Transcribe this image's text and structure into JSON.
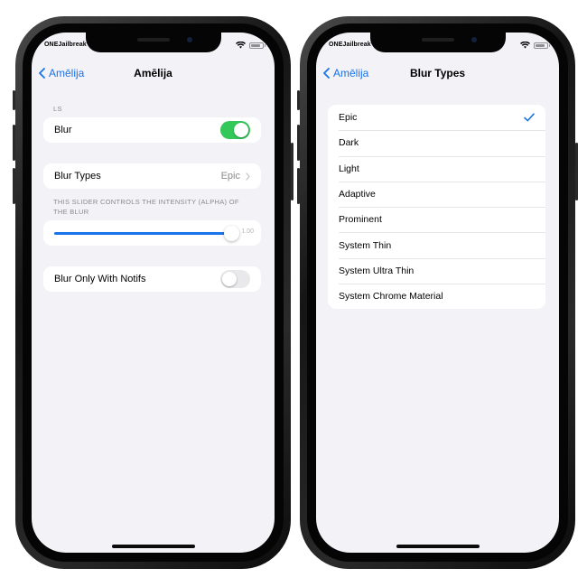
{
  "colors": {
    "accent": "#1a73e8",
    "toggle_on": "#34c759",
    "background": "#f2f2f7"
  },
  "left_screen": {
    "status": {
      "carrier": "ONEJailbreak"
    },
    "nav": {
      "back_label": "Amēlija",
      "title": "Amēlija"
    },
    "ls_header": "LS",
    "blur_label": "Blur",
    "blur_on": true,
    "blur_types_label": "Blur Types",
    "blur_types_value": "Epic",
    "slider_note": "This slider controls the intensity (alpha) of the blur",
    "slider_value_text": "1.00",
    "slider_level": 1.0,
    "notifs_label": "Blur Only With Notifs",
    "notifs_on": false
  },
  "right_screen": {
    "status": {
      "carrier": "ONEJailbreak"
    },
    "nav": {
      "back_label": "Amēlija",
      "title": "Blur Types"
    },
    "options": [
      "Epic",
      "Dark",
      "Light",
      "Adaptive",
      "Prominent",
      "System Thin",
      "System Ultra Thin",
      "System Chrome Material"
    ],
    "selected": "Epic",
    "check_icon": "checkmark-icon"
  }
}
